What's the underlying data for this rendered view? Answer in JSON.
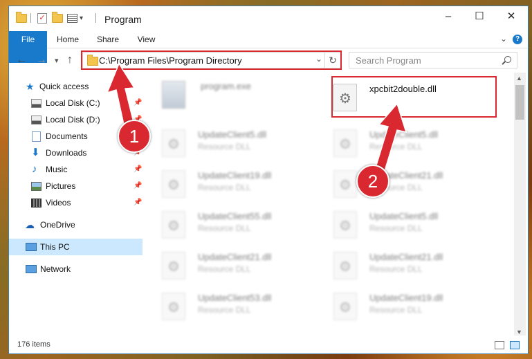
{
  "window": {
    "title": "Program",
    "controls": {
      "minimize": "–",
      "maximize": "☐",
      "close": "✕"
    }
  },
  "ribbon": {
    "tabs": [
      {
        "label": "File"
      },
      {
        "label": "Home"
      },
      {
        "label": "Share"
      },
      {
        "label": "View"
      }
    ],
    "help_icon": "?"
  },
  "nav": {
    "back": "←",
    "forward": "→",
    "recent": "▾",
    "up": "↑",
    "address": "C:\\Program Files\\Program Directory",
    "search_placeholder": "Search Program",
    "dropdown": "⌄",
    "refresh": "↻"
  },
  "sidebar": {
    "items": [
      {
        "label": "Quick access",
        "icon": "star-icon"
      },
      {
        "label": "Local Disk (C:)",
        "icon": "drive-icon"
      },
      {
        "label": "Local Disk (D:)",
        "icon": "drive-icon"
      },
      {
        "label": "Documents",
        "icon": "documents-icon"
      },
      {
        "label": "Downloads",
        "icon": "download-icon"
      },
      {
        "label": "Music",
        "icon": "music-icon"
      },
      {
        "label": "Pictures",
        "icon": "pictures-icon"
      },
      {
        "label": "Videos",
        "icon": "videos-icon"
      },
      {
        "label": "OneDrive",
        "icon": "cloud-icon"
      },
      {
        "label": "This PC",
        "icon": "computer-icon"
      },
      {
        "label": "Network",
        "icon": "network-icon"
      }
    ]
  },
  "files": {
    "program": {
      "name": "program.exe"
    },
    "target": {
      "name": "xpcbit2double.dll"
    },
    "blurred": [
      {
        "name": "UpdateClient5.dll",
        "type": "Resource DLL"
      },
      {
        "name": "UpdateClient5.dll",
        "type": "Resource DLL"
      },
      {
        "name": "UpdateClient19.dll",
        "type": "Resource DLL"
      },
      {
        "name": "UpdateClient21.dll",
        "type": "Resource DLL"
      },
      {
        "name": "UpdateClient55.dll",
        "type": "Resource DLL"
      },
      {
        "name": "UpdateClient5.dll",
        "type": "Resource DLL"
      },
      {
        "name": "UpdateClient21.dll",
        "type": "Resource DLL"
      },
      {
        "name": "UpdateClient21.dll",
        "type": "Resource DLL"
      },
      {
        "name": "UpdateClient53.dll",
        "type": "Resource DLL"
      },
      {
        "name": "UpdateClient19.dll",
        "type": "Resource DLL"
      }
    ]
  },
  "status": {
    "count": "176 items"
  },
  "annotations": {
    "badge1": "1",
    "badge2": "2"
  },
  "colors": {
    "accent": "#1979ca",
    "highlight": "#d9282f",
    "selection": "#cce8ff"
  }
}
